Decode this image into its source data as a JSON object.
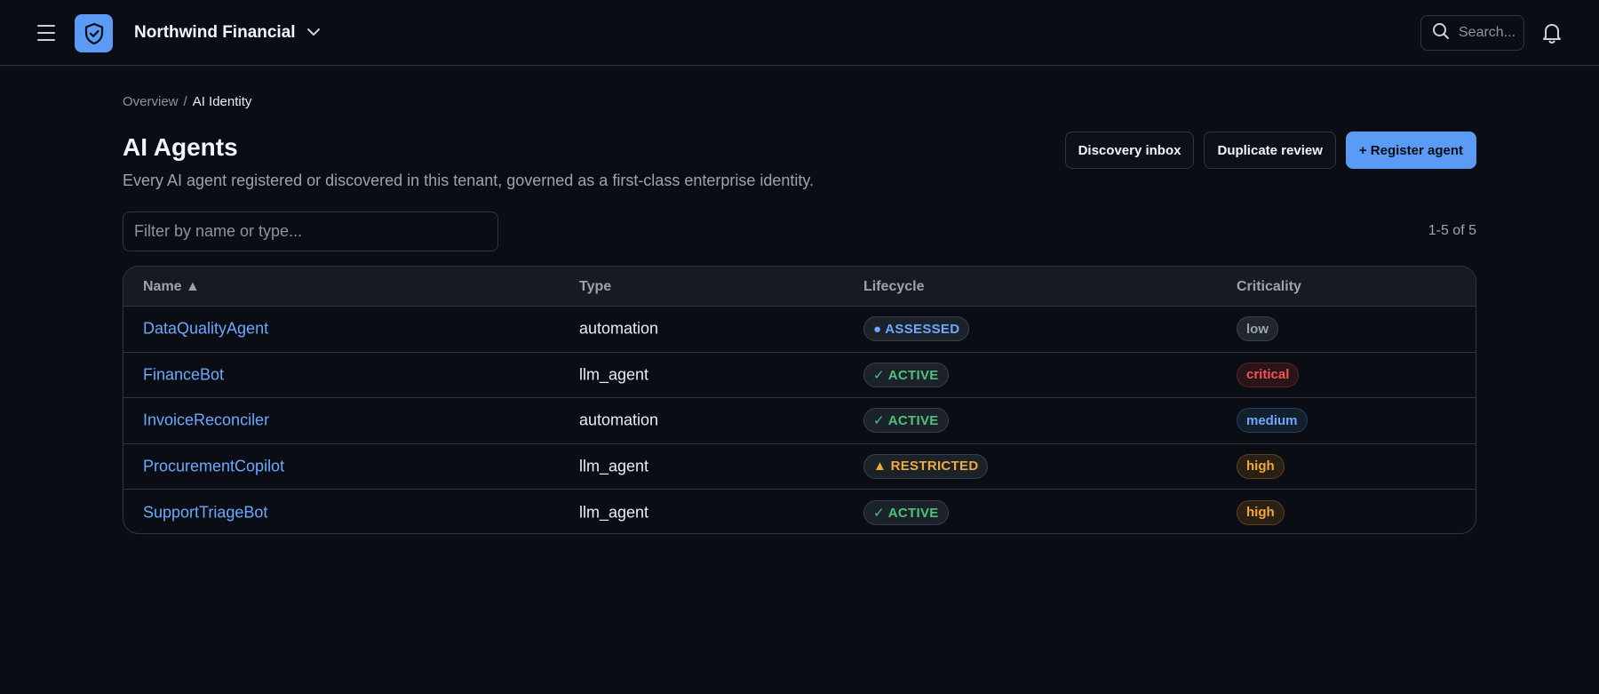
{
  "header": {
    "tenant_name": "Northwind Financial",
    "search_placeholder": "Search...",
    "icons": {
      "menu": "hamburger-icon",
      "logo": "shield-check-icon",
      "tenant_dropdown": "chevron-down-icon",
      "search": "search-icon",
      "notifications": "bell-icon"
    },
    "logo_color": "#5b9bf5"
  },
  "breadcrumb": {
    "parent": "Overview",
    "separator": "/",
    "current": "AI Identity"
  },
  "page": {
    "title": "AI Agents",
    "description": "Every AI agent registered or discovered in this tenant, governed as a first-class enterprise identity."
  },
  "actions": {
    "discovery_inbox": "Discovery inbox",
    "duplicate_review": "Duplicate review",
    "register_agent": "+ Register agent"
  },
  "filter": {
    "placeholder": "Filter by name or type...",
    "value": ""
  },
  "pagination": {
    "summary": "1-5 of 5"
  },
  "table": {
    "columns": {
      "name": "Name ▲",
      "type": "Type",
      "lifecycle": "Lifecycle",
      "criticality": "Criticality"
    },
    "rows": [
      {
        "name": "DataQualityAgent",
        "type": "automation",
        "lifecycle": "● ASSESSED",
        "lifecycle_color": "#6ea8fe",
        "criticality": "low",
        "criticality_color": "#9aa4af",
        "criticality_bg": "#20262d",
        "criticality_border": "#3a414a"
      },
      {
        "name": "FinanceBot",
        "type": "llm_agent",
        "lifecycle": "✓ ACTIVE",
        "lifecycle_color": "#4ec27a",
        "criticality": "critical",
        "criticality_color": "#f2555a",
        "criticality_bg": "#2a1418",
        "criticality_border": "#5a2228"
      },
      {
        "name": "InvoiceReconciler",
        "type": "automation",
        "lifecycle": "✓ ACTIVE",
        "lifecycle_color": "#4ec27a",
        "criticality": "medium",
        "criticality_color": "#6ea8fe",
        "criticality_bg": "#141f2e",
        "criticality_border": "#27405f"
      },
      {
        "name": "ProcurementCopilot",
        "type": "llm_agent",
        "lifecycle": "▲ RESTRICTED",
        "lifecycle_color": "#f0a93a",
        "criticality": "high",
        "criticality_color": "#f0a93a",
        "criticality_bg": "#2a2014",
        "criticality_border": "#5a4220"
      },
      {
        "name": "SupportTriageBot",
        "type": "llm_agent",
        "lifecycle": "✓ ACTIVE",
        "lifecycle_color": "#4ec27a",
        "criticality": "high",
        "criticality_color": "#f0a93a",
        "criticality_bg": "#2a2014",
        "criticality_border": "#5a4220"
      }
    ]
  }
}
